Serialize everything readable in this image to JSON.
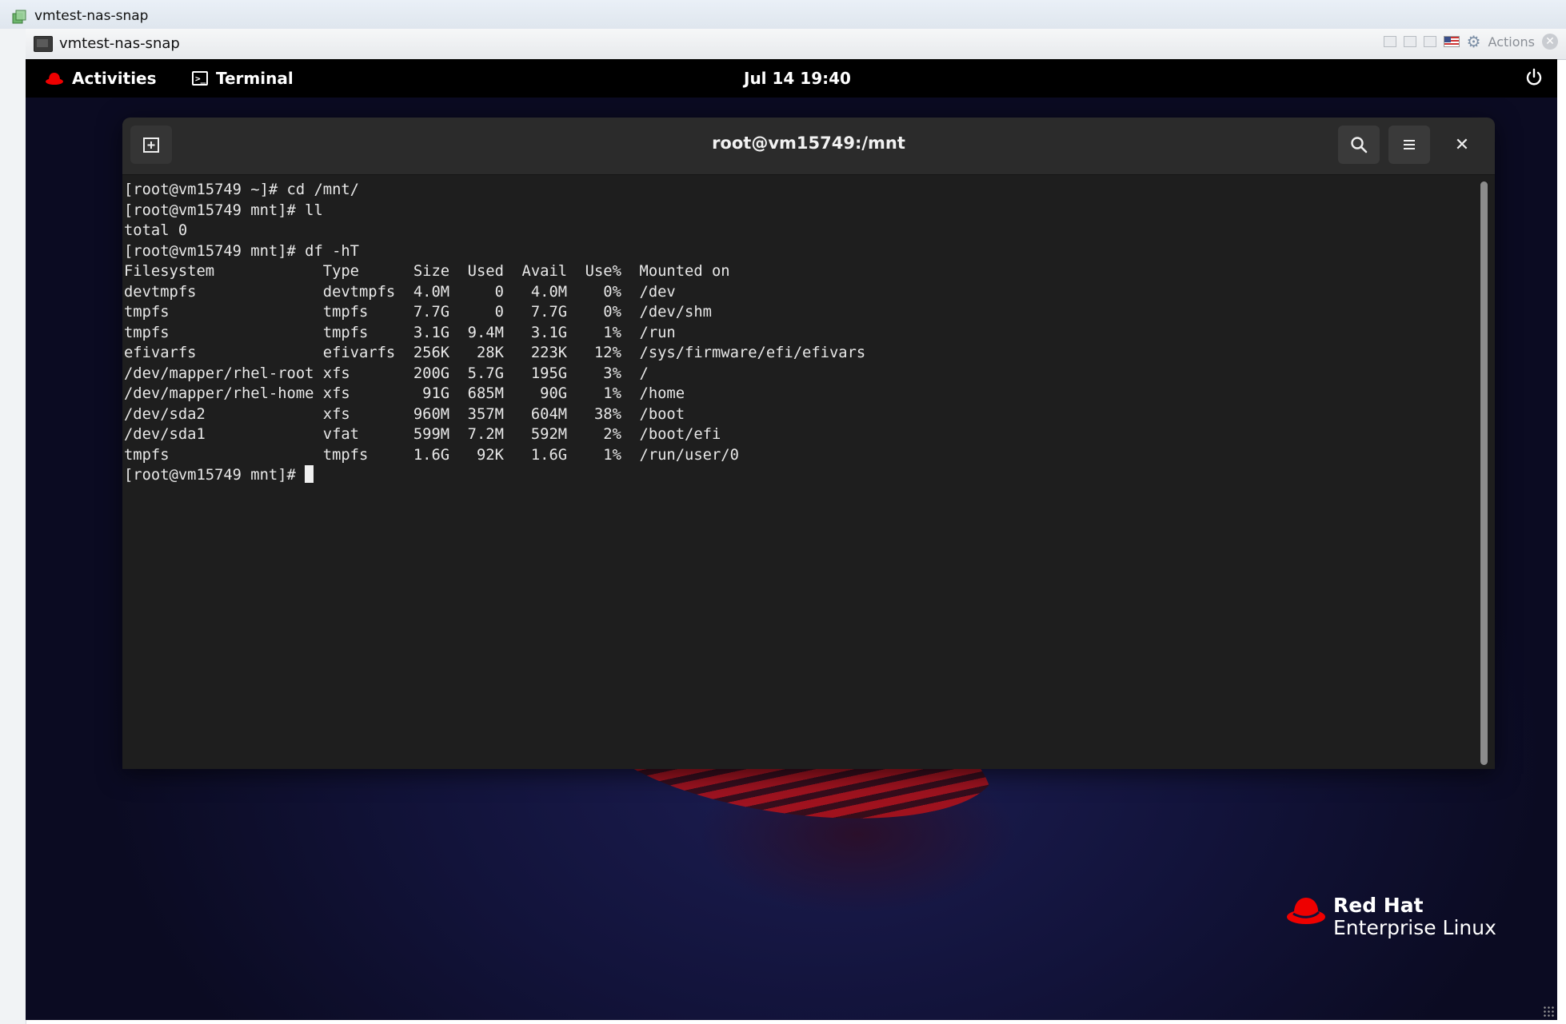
{
  "outer_window": {
    "title": "vmtest-nas-snap"
  },
  "console_bar": {
    "title": "vmtest-nas-snap",
    "actions_label": "Actions"
  },
  "gnome_topbar": {
    "activities_label": "Activities",
    "app_label": "Terminal",
    "clock": "Jul 14  19:40"
  },
  "terminal": {
    "window_title": "root@vm15749:/mnt",
    "lines": [
      "[root@vm15749 ~]# cd /mnt/",
      "[root@vm15749 mnt]# ll",
      "total 0",
      "[root@vm15749 mnt]# df -hT",
      "Filesystem            Type      Size  Used  Avail  Use%  Mounted on",
      "devtmpfs              devtmpfs  4.0M     0   4.0M    0%  /dev",
      "tmpfs                 tmpfs     7.7G     0   7.7G    0%  /dev/shm",
      "tmpfs                 tmpfs     3.1G  9.4M   3.1G    1%  /run",
      "efivarfs              efivarfs  256K   28K   223K   12%  /sys/firmware/efi/efivars",
      "/dev/mapper/rhel-root xfs       200G  5.7G   195G    3%  /",
      "/dev/mapper/rhel-home xfs        91G  685M    90G    1%  /home",
      "/dev/sda2             xfs       960M  357M   604M   38%  /boot",
      "/dev/sda1             vfat      599M  7.2M   592M    2%  /boot/efi",
      "tmpfs                 tmpfs     1.6G   92K   1.6G    1%  /run/user/0"
    ],
    "prompt": "[root@vm15749 mnt]# "
  },
  "branding": {
    "line1": "Red Hat",
    "line2": "Enterprise Linux"
  },
  "colors": {
    "terminal_bg": "#1e1e1e",
    "header_bg": "#2b2b2b",
    "topbar_bg": "#000000",
    "redhat_red": "#ee0000"
  },
  "icons": [
    "app-icon",
    "monitor-icon",
    "gear-icon",
    "close-icon",
    "redhat-hat-icon",
    "terminal-icon",
    "power-icon",
    "new-tab-icon",
    "search-icon",
    "hamburger-menu-icon"
  ]
}
